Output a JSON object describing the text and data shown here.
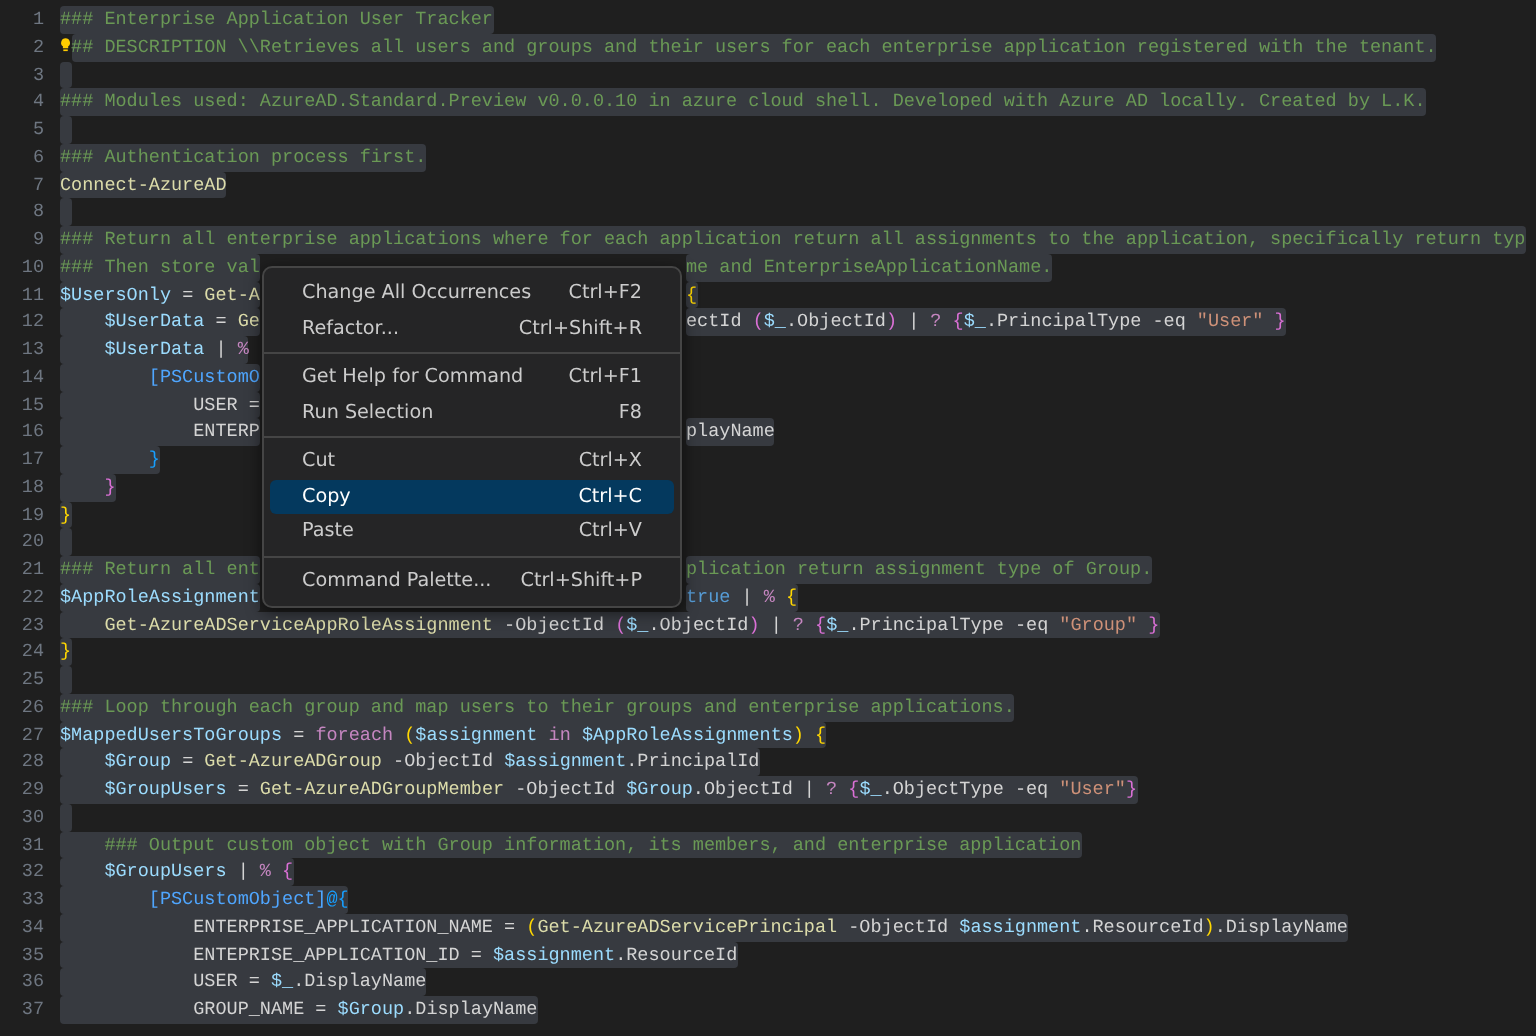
{
  "editor": {
    "lines": [
      {
        "number": "1",
        "selected": true,
        "tokens": [
          {
            "text": "### Enterprise Application User Tracker",
            "kind": "comment"
          }
        ]
      },
      {
        "number": "2",
        "selected": true,
        "code_action": true,
        "tokens": [
          {
            "text": "## DESCRIPTION \\\\Retrieves all users and groups and their users for each enterprise application registered with the tenant.",
            "kind": "comment"
          }
        ]
      },
      {
        "number": "3",
        "selected": true
      },
      {
        "number": "4",
        "selected": true,
        "tokens": [
          {
            "text": "### Modules used: AzureAD.Standard.Preview v0.0.0.10 in azure cloud shell. Developed with Azure AD locally. Created by L.K.",
            "kind": "comment"
          }
        ]
      },
      {
        "number": "5",
        "selected": true
      },
      {
        "number": "6",
        "selected": true,
        "tokens": [
          {
            "text": "### Authentication process first.",
            "kind": "comment"
          }
        ]
      },
      {
        "number": "7",
        "selected": true,
        "tokens": [
          {
            "text": "Connect-AzureAD",
            "kind": "command"
          }
        ]
      },
      {
        "number": "8",
        "selected": true
      },
      {
        "number": "9",
        "selected": true,
        "tokens": [
          {
            "text": "### Return all enterprise applications where for each application return all assignments to the application, specifically return typ",
            "kind": "comment"
          }
        ]
      },
      {
        "number": "10",
        "selected": true,
        "tokens": [
          {
            "text": "### Then store val",
            "kind": "comment"
          },
          {
            "kind": "covered"
          },
          {
            "text": "me and EnterpriseApplicationName.",
            "kind": "comment"
          }
        ]
      },
      {
        "number": "11",
        "selected": true,
        "tokens": [
          {
            "text": "$UsersOnly",
            "kind": "variable"
          },
          {
            "text": " = ",
            "kind": "plain"
          },
          {
            "text": "Get-A",
            "kind": "command"
          },
          {
            "kind": "covered"
          },
          {
            "text": "{",
            "kind": "brace1"
          }
        ]
      },
      {
        "number": "12",
        "selected": true,
        "tokens": [
          {
            "text": "    $UserData",
            "kind": "variable"
          },
          {
            "text": " = ",
            "kind": "plain"
          },
          {
            "text": "Ge",
            "kind": "command"
          },
          {
            "kind": "covered"
          },
          {
            "text": "ectId ",
            "kind": "plain"
          },
          {
            "text": "(",
            "kind": "brace2"
          },
          {
            "text": "$_",
            "kind": "variable"
          },
          {
            "text": ".ObjectId",
            "kind": "plain"
          },
          {
            "text": ")",
            "kind": "brace2"
          },
          {
            "text": " | ",
            "kind": "plain"
          },
          {
            "text": "? ",
            "kind": "operator"
          },
          {
            "text": "{",
            "kind": "brace2"
          },
          {
            "text": "$_",
            "kind": "variable"
          },
          {
            "text": ".PrincipalType -eq ",
            "kind": "plain"
          },
          {
            "text": "\"User\" ",
            "kind": "string"
          },
          {
            "text": "}",
            "kind": "brace2"
          }
        ]
      },
      {
        "number": "13",
        "selected": true,
        "tokens": [
          {
            "text": "    $UserData",
            "kind": "variable"
          },
          {
            "text": " | ",
            "kind": "plain"
          },
          {
            "text": "%",
            "kind": "operator"
          },
          {
            "kind": "covered"
          }
        ]
      },
      {
        "number": "14",
        "selected": true,
        "tokens": [
          {
            "text": "        [PSCustomO",
            "kind": "type"
          },
          {
            "kind": "covered"
          }
        ]
      },
      {
        "number": "15",
        "selected": true,
        "tokens": [
          {
            "text": "            USER =",
            "kind": "plain"
          },
          {
            "kind": "covered"
          }
        ]
      },
      {
        "number": "16",
        "selected": true,
        "tokens": [
          {
            "text": "            ENTERP",
            "kind": "plain"
          },
          {
            "kind": "covered"
          },
          {
            "text": "playName",
            "kind": "plain"
          }
        ]
      },
      {
        "number": "17",
        "selected": true,
        "tokens": [
          {
            "text": "        }",
            "kind": "brace3"
          }
        ]
      },
      {
        "number": "18",
        "selected": true,
        "tokens": [
          {
            "text": "    }",
            "kind": "brace2"
          }
        ]
      },
      {
        "number": "19",
        "selected": true,
        "tokens": [
          {
            "text": "}",
            "kind": "brace1"
          }
        ]
      },
      {
        "number": "20",
        "selected": true
      },
      {
        "number": "21",
        "selected": true,
        "tokens": [
          {
            "text": "### Return all ent",
            "kind": "comment"
          },
          {
            "kind": "covered"
          },
          {
            "text": "plication return assignment type of Group.",
            "kind": "comment"
          }
        ]
      },
      {
        "number": "22",
        "selected": true,
        "tokens": [
          {
            "text": "$AppRoleAssignment",
            "kind": "variable"
          },
          {
            "kind": "covered"
          },
          {
            "text": "true",
            "kind": "constant"
          },
          {
            "text": " | ",
            "kind": "plain"
          },
          {
            "text": "% ",
            "kind": "operator"
          },
          {
            "text": "{",
            "kind": "brace1"
          }
        ]
      },
      {
        "number": "23",
        "selected": true,
        "tokens": [
          {
            "text": "    Get-AzureADServiceAppRoleAssignment",
            "kind": "command"
          },
          {
            "text": " -ObjectId ",
            "kind": "plain"
          },
          {
            "text": "(",
            "kind": "brace2"
          },
          {
            "text": "$_",
            "kind": "variable"
          },
          {
            "text": ".ObjectId",
            "kind": "plain"
          },
          {
            "text": ")",
            "kind": "brace2"
          },
          {
            "text": " | ",
            "kind": "plain"
          },
          {
            "text": "? ",
            "kind": "operator"
          },
          {
            "text": "{",
            "kind": "brace2"
          },
          {
            "text": "$_",
            "kind": "variable"
          },
          {
            "text": ".PrincipalType -eq ",
            "kind": "plain"
          },
          {
            "text": "\"Group\" ",
            "kind": "string"
          },
          {
            "text": "}",
            "kind": "brace2"
          }
        ]
      },
      {
        "number": "24",
        "selected": true,
        "tokens": [
          {
            "text": "}",
            "kind": "brace1"
          }
        ]
      },
      {
        "number": "25",
        "selected": true
      },
      {
        "number": "26",
        "selected": true,
        "tokens": [
          {
            "text": "### Loop through each group and map users to their groups and enterprise applications.",
            "kind": "comment"
          }
        ]
      },
      {
        "number": "27",
        "selected": true,
        "tokens": [
          {
            "text": "$MappedUsersToGroups",
            "kind": "variable"
          },
          {
            "text": " = ",
            "kind": "plain"
          },
          {
            "text": "foreach ",
            "kind": "keyword"
          },
          {
            "text": "(",
            "kind": "brace1"
          },
          {
            "text": "$assignment ",
            "kind": "variable"
          },
          {
            "text": "in ",
            "kind": "keyword"
          },
          {
            "text": "$AppRoleAssignments",
            "kind": "variable"
          },
          {
            "text": ")",
            "kind": "brace1"
          },
          {
            "text": " {",
            "kind": "brace1"
          }
        ]
      },
      {
        "number": "28",
        "selected": true,
        "tokens": [
          {
            "text": "    $Group",
            "kind": "variable"
          },
          {
            "text": " = ",
            "kind": "plain"
          },
          {
            "text": "Get-AzureADGroup",
            "kind": "command"
          },
          {
            "text": " -ObjectId ",
            "kind": "plain"
          },
          {
            "text": "$assignment",
            "kind": "variable"
          },
          {
            "text": ".PrincipalId",
            "kind": "plain"
          }
        ]
      },
      {
        "number": "29",
        "selected": true,
        "tokens": [
          {
            "text": "    $GroupUsers",
            "kind": "variable"
          },
          {
            "text": " = ",
            "kind": "plain"
          },
          {
            "text": "Get-AzureADGroupMember",
            "kind": "command"
          },
          {
            "text": " -ObjectId ",
            "kind": "plain"
          },
          {
            "text": "$Group",
            "kind": "variable"
          },
          {
            "text": ".ObjectId | ",
            "kind": "plain"
          },
          {
            "text": "? ",
            "kind": "operator"
          },
          {
            "text": "{",
            "kind": "brace2"
          },
          {
            "text": "$_",
            "kind": "variable"
          },
          {
            "text": ".ObjectType -eq ",
            "kind": "plain"
          },
          {
            "text": "\"User\"",
            "kind": "string"
          },
          {
            "text": "}",
            "kind": "brace2"
          }
        ]
      },
      {
        "number": "30",
        "selected": true
      },
      {
        "number": "31",
        "selected": true,
        "tokens": [
          {
            "text": "    ### Output custom object with Group information, its members, and enterprise application",
            "kind": "comment"
          }
        ]
      },
      {
        "number": "32",
        "selected": true,
        "tokens": [
          {
            "text": "    $GroupUsers",
            "kind": "variable"
          },
          {
            "text": " | ",
            "kind": "plain"
          },
          {
            "text": "% ",
            "kind": "operator"
          },
          {
            "text": "{",
            "kind": "brace2"
          }
        ]
      },
      {
        "number": "33",
        "selected": true,
        "tokens": [
          {
            "text": "        [PSCustomObject]",
            "kind": "type"
          },
          {
            "text": "@{",
            "kind": "brace3"
          }
        ]
      },
      {
        "number": "34",
        "selected": true,
        "tokens": [
          {
            "text": "            ENTERPRISE_APPLICATION_NAME = ",
            "kind": "plain"
          },
          {
            "text": "(",
            "kind": "brace1"
          },
          {
            "text": "Get-AzureADServicePrincipal",
            "kind": "command"
          },
          {
            "text": " -ObjectId ",
            "kind": "plain"
          },
          {
            "text": "$assignment",
            "kind": "variable"
          },
          {
            "text": ".ResourceId",
            "kind": "plain"
          },
          {
            "text": ")",
            "kind": "brace1"
          },
          {
            "text": ".DisplayName",
            "kind": "plain"
          }
        ]
      },
      {
        "number": "35",
        "selected": true,
        "tokens": [
          {
            "text": "            ENTEPRISE_APPLICATION_ID = ",
            "kind": "plain"
          },
          {
            "text": "$assignment",
            "kind": "variable"
          },
          {
            "text": ".ResourceId",
            "kind": "plain"
          }
        ]
      },
      {
        "number": "36",
        "selected": true,
        "tokens": [
          {
            "text": "            USER = ",
            "kind": "plain"
          },
          {
            "text": "$_",
            "kind": "variable"
          },
          {
            "text": ".DisplayName",
            "kind": "plain"
          }
        ]
      },
      {
        "number": "37",
        "selected": true,
        "tokens": [
          {
            "text": "            GROUP_NAME = ",
            "kind": "plain"
          },
          {
            "text": "$Group",
            "kind": "variable"
          },
          {
            "text": ".DisplayName",
            "kind": "plain"
          }
        ]
      }
    ]
  },
  "context_menu": {
    "groups": [
      [
        {
          "label": "Change All Occurrences",
          "shortcut": "Ctrl+F2",
          "selected": false
        },
        {
          "label": "Refactor...",
          "shortcut": "Ctrl+Shift+R",
          "selected": false
        }
      ],
      [
        {
          "label": "Get Help for Command",
          "shortcut": "Ctrl+F1",
          "selected": false
        },
        {
          "label": "Run Selection",
          "shortcut": "F8",
          "selected": false
        }
      ],
      [
        {
          "label": "Cut",
          "shortcut": "Ctrl+X",
          "selected": false
        },
        {
          "label": "Copy",
          "shortcut": "Ctrl+C",
          "selected": true
        },
        {
          "label": "Paste",
          "shortcut": "Ctrl+V",
          "selected": false
        }
      ],
      [
        {
          "label": "Command Palette...",
          "shortcut": "Ctrl+Shift+P",
          "selected": false
        }
      ]
    ]
  }
}
